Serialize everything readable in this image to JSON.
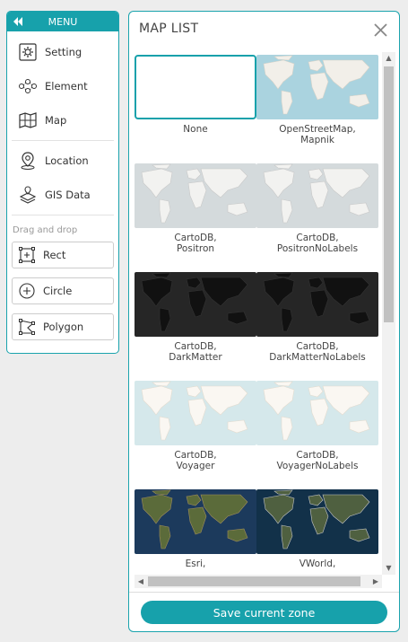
{
  "menu": {
    "title": "MENU",
    "items": [
      {
        "label": "Setting",
        "icon": "gear-icon"
      },
      {
        "label": "Element",
        "icon": "element-nodes-icon"
      },
      {
        "label": "Map",
        "icon": "map-icon"
      },
      {
        "label": "Location",
        "icon": "location-pin-icon"
      },
      {
        "label": "GIS Data",
        "icon": "layers-icon"
      }
    ],
    "drag_drop_label": "Drag and drop",
    "tools": [
      {
        "label": "Rect",
        "icon": "rect-tool-icon"
      },
      {
        "label": "Circle",
        "icon": "circle-tool-icon"
      },
      {
        "label": "Polygon",
        "icon": "polygon-tool-icon"
      }
    ]
  },
  "map_list": {
    "title": "MAP LIST",
    "tiles": [
      {
        "line1": "None",
        "line2": "",
        "style": "none",
        "selected": true
      },
      {
        "line1": "OpenStreetMap,",
        "line2": "Mapnik",
        "style": "osm"
      },
      {
        "line1": "CartoDB,",
        "line2": "Positron",
        "style": "positron"
      },
      {
        "line1": "CartoDB,",
        "line2": "PositronNoLabels",
        "style": "positron"
      },
      {
        "line1": "CartoDB,",
        "line2": "DarkMatter",
        "style": "dark"
      },
      {
        "line1": "CartoDB,",
        "line2": "DarkMatterNoLabels",
        "style": "dark"
      },
      {
        "line1": "CartoDB,",
        "line2": "Voyager",
        "style": "voyager"
      },
      {
        "line1": "CartoDB,",
        "line2": "VoyagerNoLabels",
        "style": "voyager"
      },
      {
        "line1": "Esri,",
        "line2": "",
        "style": "satellite"
      },
      {
        "line1": "VWorld,",
        "line2": "",
        "style": "vworld"
      }
    ],
    "save_label": "Save current zone"
  },
  "colors": {
    "accent": "#17a1ab"
  }
}
